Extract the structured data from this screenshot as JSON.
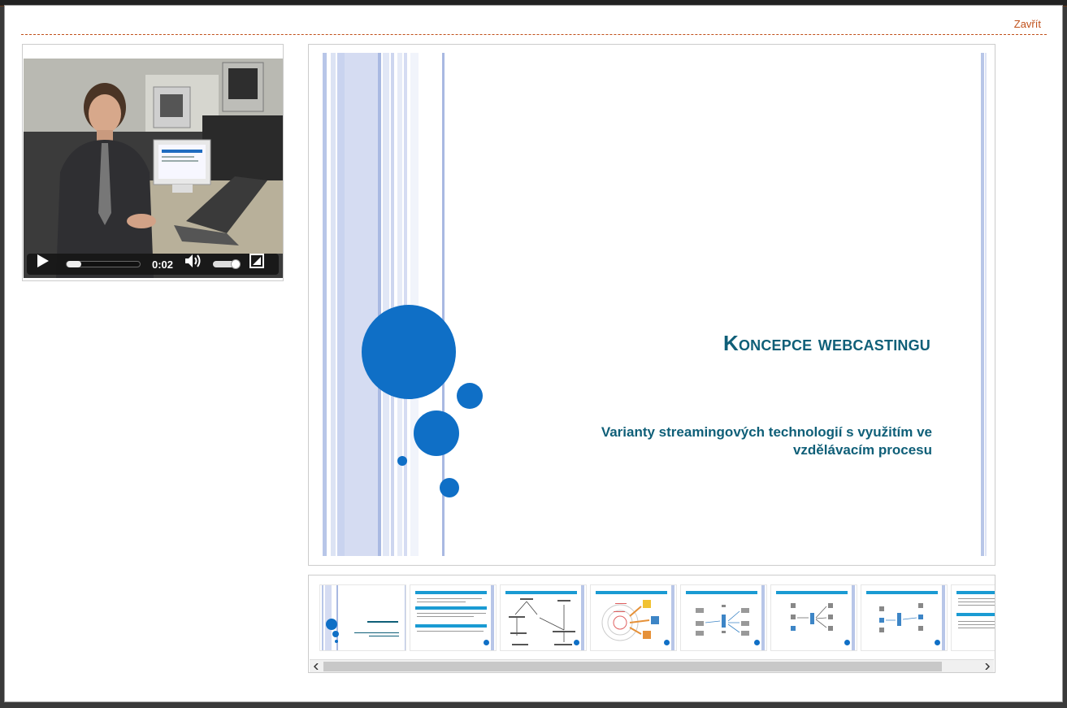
{
  "dialog": {
    "close_label": "Zavřít"
  },
  "video": {
    "time": "0:02",
    "progress": 0.0
  },
  "slide": {
    "title": "Koncepce webcastingu",
    "subtitle": "Varianty streamingových technologií s využitím ve vzdělávacím procesu"
  },
  "colors": {
    "accent": "#c0501a",
    "slide_text": "#0f5f78",
    "slide_circle": "#0f6fc6",
    "slide_stripe": "#b8c6e8"
  },
  "icons": {
    "play": "play-icon",
    "volume": "volume-icon",
    "fullscreen": "fullscreen-icon",
    "scroll_left": "chevron-left-icon",
    "scroll_right": "chevron-right-icon"
  }
}
